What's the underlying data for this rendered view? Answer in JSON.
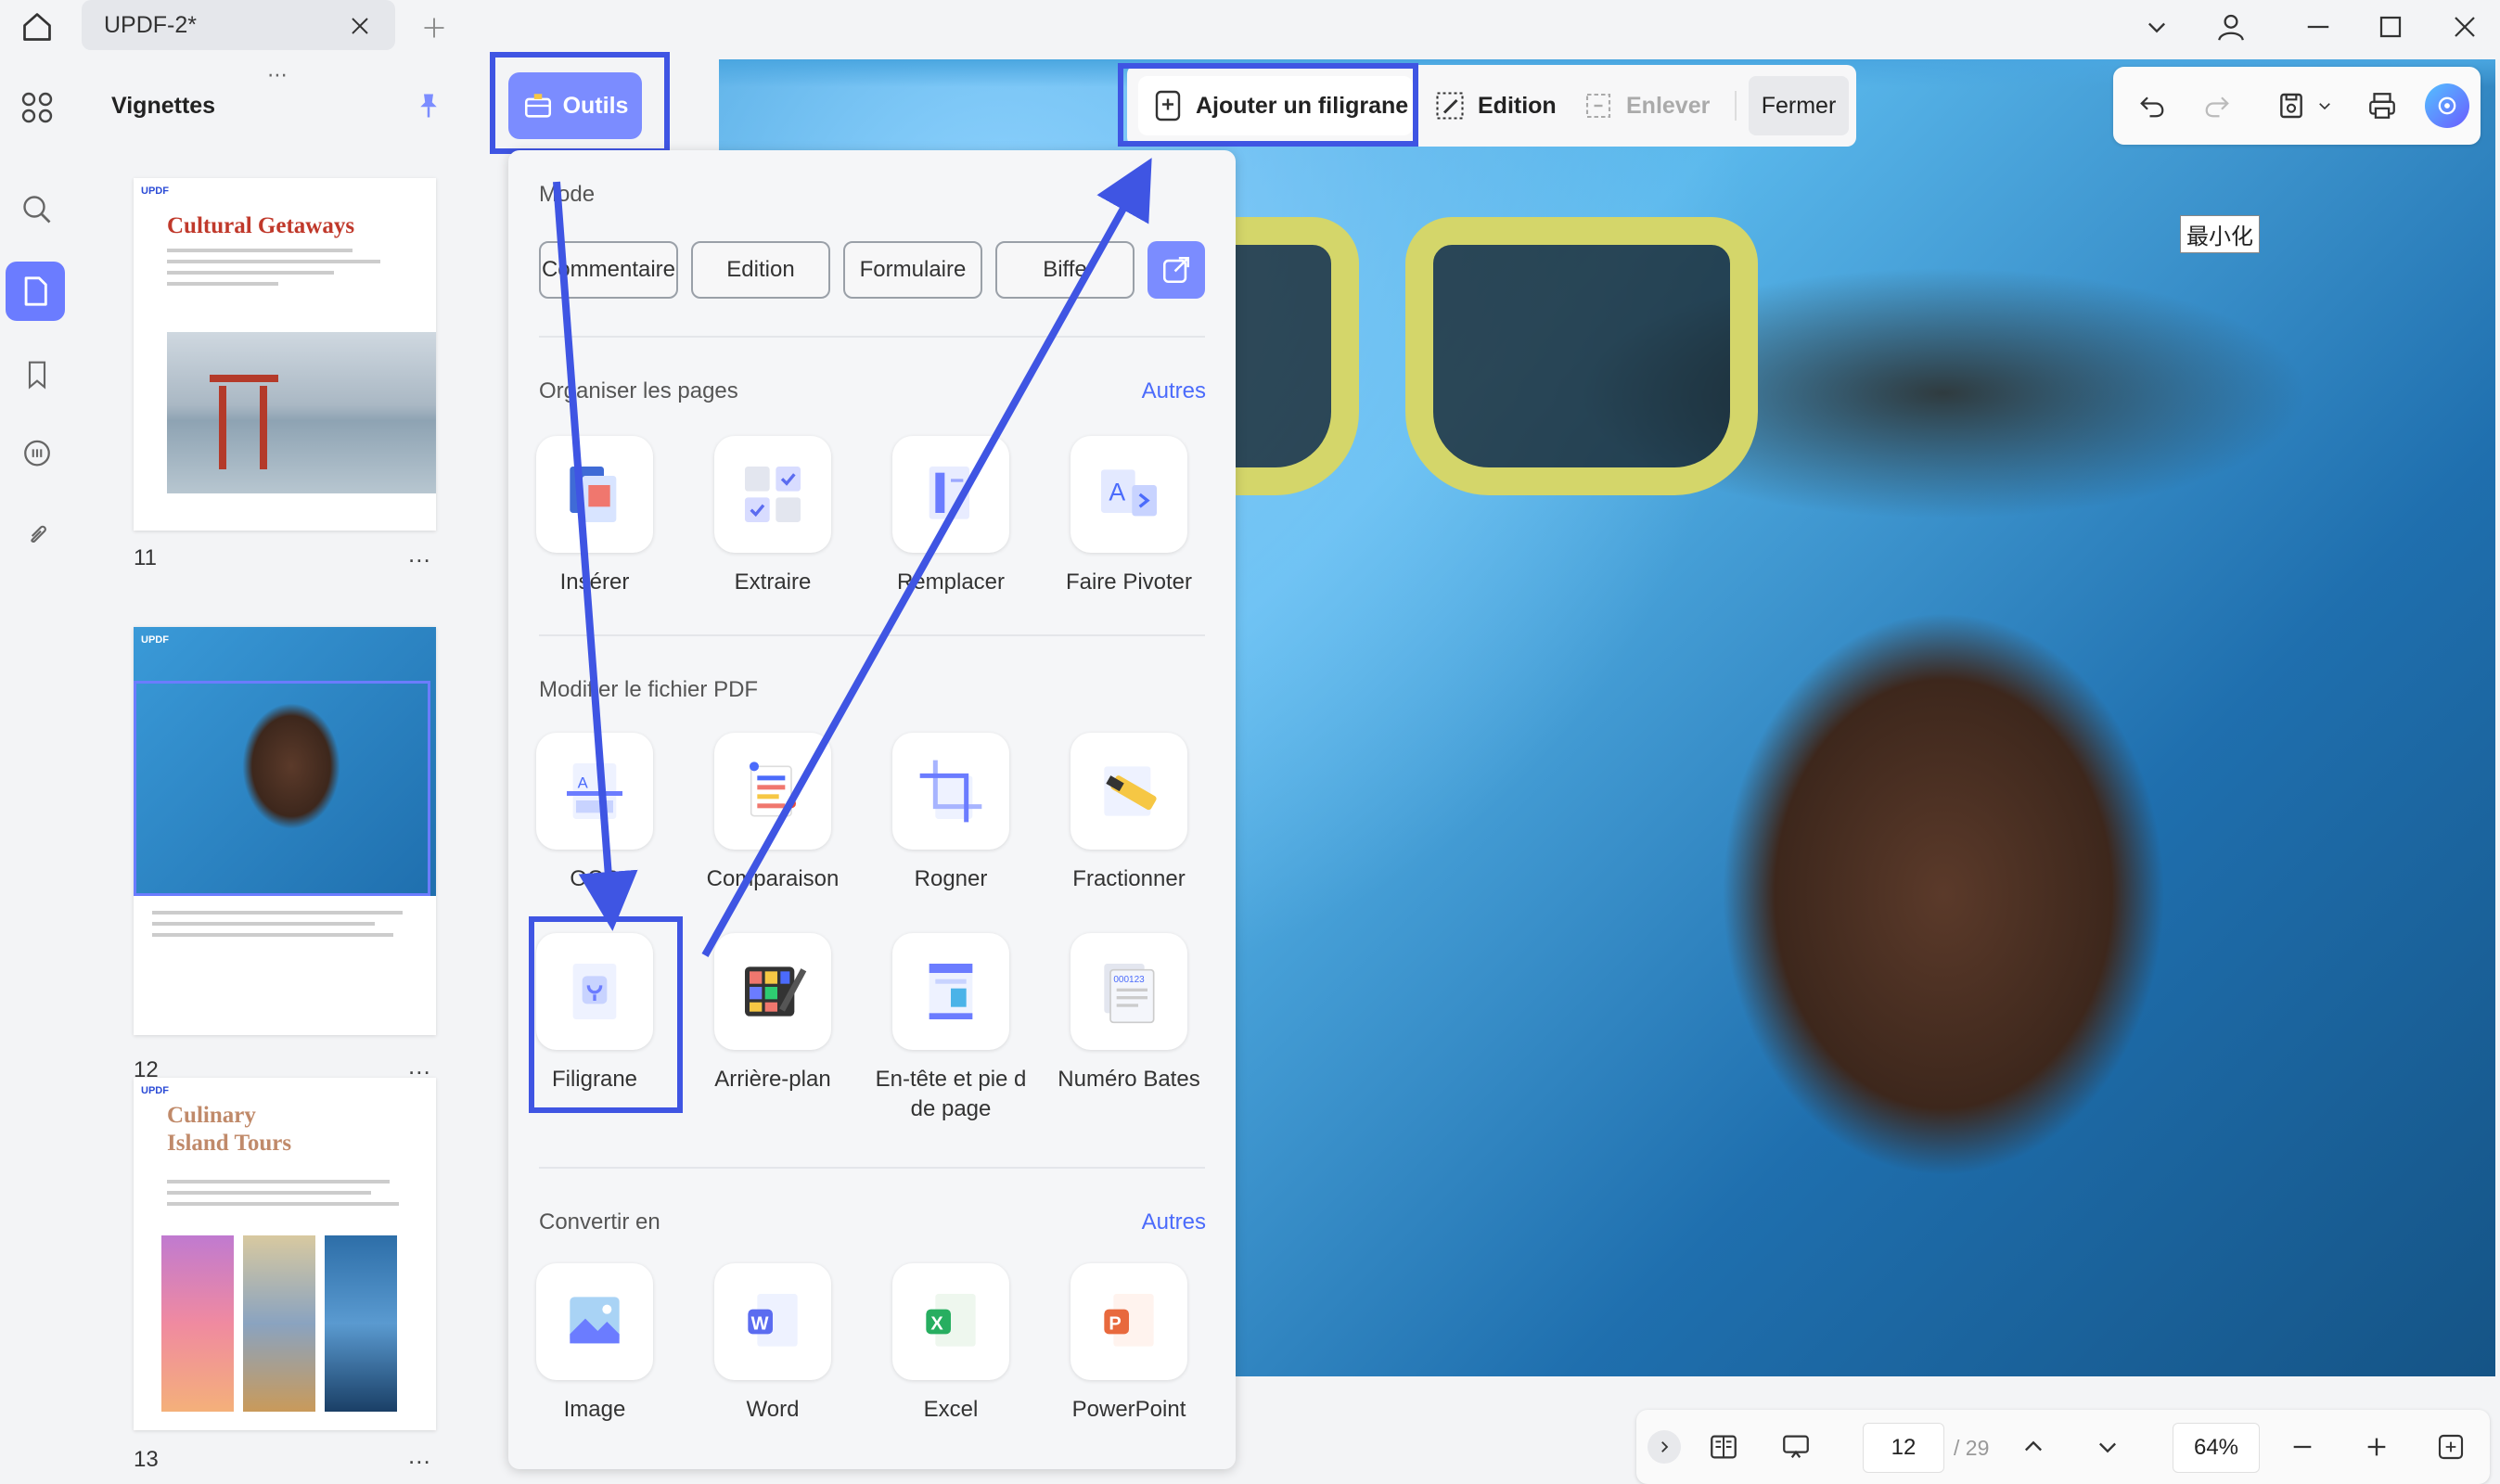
{
  "window": {
    "tab_title": "UPDF-2*"
  },
  "sidebar": {
    "title": "Vignettes",
    "pages": [
      {
        "number": "11",
        "heading": "Cultural Getaways",
        "more": "..."
      },
      {
        "number": "12",
        "heading": "",
        "more": "..."
      },
      {
        "number": "13",
        "heading": "Culinary Island Tours",
        "more": "..."
      }
    ],
    "thumb_badge": "UPDF",
    "thumb13_line1": "Culinary",
    "thumb13_line2": "Island Tours"
  },
  "toolbar": {
    "outils_label": "Outils",
    "add_watermark_label": "Ajouter un filigrane",
    "edition_label": "Edition",
    "remove_label": "Enlever",
    "close_label": "Fermer"
  },
  "overlay_text": "最小化",
  "panel": {
    "mode": {
      "title": "Mode",
      "buttons": [
        "Commentaire",
        "Edition",
        "Formulaire",
        "Biffe"
      ]
    },
    "organize": {
      "title": "Organiser les pages",
      "more": "Autres",
      "tools": [
        "Insérer",
        "Extraire",
        "Remplacer",
        "Faire Pivoter"
      ]
    },
    "modify": {
      "title": "Modifier le fichier PDF",
      "tools": [
        "OCR",
        "Comparaison",
        "Rogner",
        "Fractionner",
        "Filigrane",
        "Arrière-plan",
        "En-tête et pie d de page",
        "Numéro Bates"
      ]
    },
    "convert": {
      "title": "Convertir en",
      "more": "Autres",
      "tools": [
        "Image",
        "Word",
        "Excel",
        "PowerPoint"
      ]
    }
  },
  "bottom": {
    "current_page": "12",
    "total_pages": "/ 29",
    "zoom": "64%"
  },
  "colors": {
    "accent": "#7b8cff",
    "highlight": "#3f55e3",
    "link": "#4b6bfb"
  }
}
